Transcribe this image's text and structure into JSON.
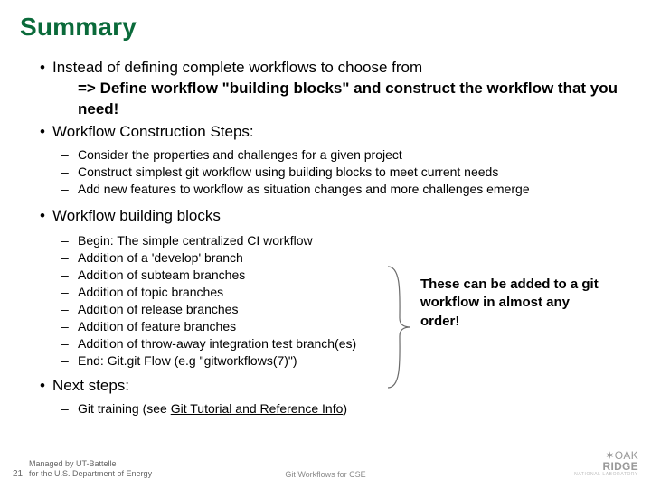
{
  "title": "Summary",
  "bullets": {
    "b1": "Instead of defining complete workflows to choose from",
    "b1_cont": "=> Define workflow \"building blocks\" and construct the workflow that you need!",
    "b2": "Workflow Construction Steps:",
    "b2_sub": [
      "Consider the properties and challenges for a given project",
      "Construct simplest git workflow using building blocks to meet current needs",
      "Add new features to workflow as situation changes and more challenges emerge"
    ],
    "b3": "Workflow building blocks",
    "b3_sub": [
      "Begin: The simple centralized CI workflow",
      "Addition of a 'develop' branch",
      "Addition of subteam branches",
      "Addition of topic branches",
      "Addition of release branches",
      "Addition of feature branches",
      "Addition of throw-away integration test branch(es)",
      "End: Git.git Flow (e.g \"gitworkflows(7)\")"
    ],
    "b4": "Next steps:",
    "b4_sub_prefix": "Git training (see ",
    "b4_sub_link": "Git Tutorial and Reference Info",
    "b4_sub_suffix": ")"
  },
  "aside": "These can be added to a git workflow in almost any order!",
  "footer": {
    "page": "21",
    "managed_l1": "Managed by UT-Battelle",
    "managed_l2": "for the U.S. Department of Energy",
    "center": "Git Workflows for CSE",
    "logo_oak": "OAK",
    "logo_ridge": "RIDGE",
    "logo_natl": "NATIONAL LABORATORY"
  }
}
